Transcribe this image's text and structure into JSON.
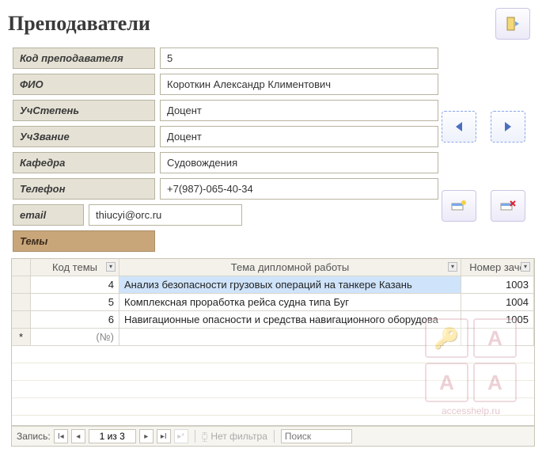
{
  "header": {
    "title": "Преподаватели"
  },
  "fields": {
    "teacher_id": {
      "label": "Код преподавателя",
      "value": "5"
    },
    "fio": {
      "label": "ФИО",
      "value": "Короткин Александр Климентович"
    },
    "degree": {
      "label": "УчСтепень",
      "value": "Доцент"
    },
    "rank": {
      "label": "УчЗвание",
      "value": "Доцент"
    },
    "dept": {
      "label": "Кафедра",
      "value": "Судовождения"
    },
    "phone": {
      "label": "Телефон",
      "value": "+7(987)-065-40-34"
    },
    "email": {
      "label": "email",
      "value": "thiucyi@orc.ru"
    }
  },
  "topics_label": "Темы",
  "grid": {
    "columns": {
      "id": "Код темы",
      "topic": "Тема дипломной работы",
      "num": "Номер заче"
    },
    "rows": [
      {
        "id": "4",
        "topic": "Анализ безопасности грузовых операций на танкере Казань",
        "num": "1003"
      },
      {
        "id": "5",
        "topic": "Комплексная проработка рейса судна типа Буг",
        "num": "1004"
      },
      {
        "id": "6",
        "topic": "Навигационные опасности и средства навигационного оборудова",
        "num": "1005"
      }
    ],
    "new_placeholder": "(№)"
  },
  "recnav": {
    "label": "Запись:",
    "position": "1 из 3",
    "no_filter": "Нет фильтра",
    "search_placeholder": "Поиск"
  },
  "watermark": "accesshelp.ru"
}
